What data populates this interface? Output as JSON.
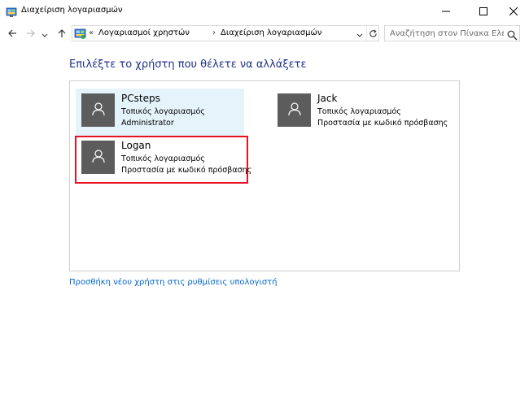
{
  "window": {
    "title": "Διαχείριση λογαριασμών",
    "app_icon": "control-panel-icon",
    "buttons": [
      "minimize-icon",
      "maximize-icon",
      "close-icon"
    ]
  },
  "navigation": {
    "back_icon": "arrow-left-icon",
    "forward_icon": "arrow-right-icon",
    "recent_icon": "chevron-down-icon",
    "up_icon": "arrow-up-icon"
  },
  "address_bar": {
    "overflow_chevron": "«",
    "breadcrumbs": [
      {
        "label": "Λογαριασμοί χρηστών"
      },
      {
        "label": "Διαχείριση λογαριασμών"
      }
    ],
    "separator": "›",
    "refresh_icon": "refresh-icon",
    "dropdown_icon": "chevron-down-icon"
  },
  "search": {
    "placeholder": "Αναζήτηση στον Πίνακα Ελέγ...",
    "value": "",
    "icon": "search-icon"
  },
  "main": {
    "heading": "Επιλέξτε το χρήστη που θέλετε να αλλάξετε",
    "users": [
      {
        "name": "PCsteps",
        "type": "Τοπικός λογαριασμός",
        "detail": "Administrator",
        "state": "selected",
        "icon": "user-icon"
      },
      {
        "name": "Jack",
        "type": "Τοπικός λογαριασμός",
        "detail": "Προστασία με κωδικό πρόσβασης",
        "state": "normal",
        "icon": "user-icon"
      },
      {
        "name": "Logan",
        "type": "Τοπικός λογαριασμός",
        "detail": "Προστασία με κωδικό πρόσβασης",
        "state": "highlighted",
        "icon": "user-icon"
      }
    ],
    "add_user_link": "Προσθήκη νέου χρήστη στις ρυθμίσεις υπολογιστή"
  },
  "colors": {
    "heading": "#1e3287",
    "link": "#0066cc",
    "selected_bg": "#e5f3fb",
    "highlight_border": "#e81123",
    "avatar_bg": "#5c5c5c"
  }
}
